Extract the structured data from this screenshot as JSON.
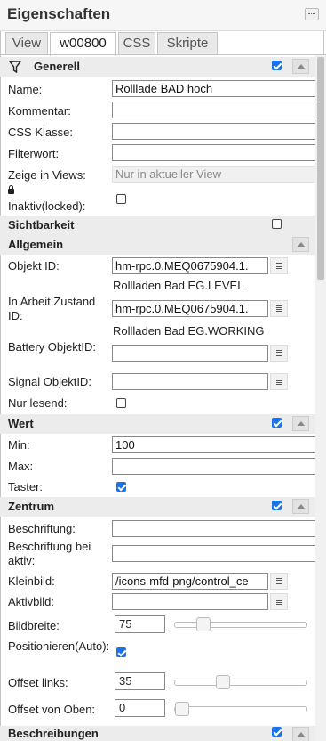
{
  "panel": {
    "title": "Eigenschaften"
  },
  "tabs": [
    {
      "label": "View"
    },
    {
      "label": "w00800"
    },
    {
      "label": "CSS"
    },
    {
      "label": "Skripte"
    }
  ],
  "generell": {
    "header": "Generell",
    "name_label": "Name:",
    "name_value": "Rolllade BAD hoch",
    "kommentar_label": "Kommentar:",
    "kommentar_value": "",
    "css_klasse_label": "CSS Klasse:",
    "css_klasse_value": "",
    "filterwort_label": "Filterwort:",
    "filterwort_value": "",
    "zeige_label": "Zeige in Views:",
    "zeige_value": "Nur in aktueller View",
    "inaktiv_label": "Inaktiv(locked):"
  },
  "sichtbarkeit": {
    "header": "Sichtbarkeit"
  },
  "allgemein": {
    "header": "Allgemein",
    "objekt_id_label": "Objekt ID:",
    "objekt_id_value": "hm-rpc.0.MEQ0675904.1.",
    "objekt_id_name": "Rollladen Bad EG.LEVEL",
    "arbeit_label": "In Arbeit Zustand ID:",
    "arbeit_value": "hm-rpc.0.MEQ0675904.1.",
    "arbeit_name": "Rollladen Bad EG.WORKING",
    "battery_label": "Battery ObjektID:",
    "battery_value": "",
    "signal_label": "Signal ObjektID:",
    "signal_value": "",
    "nur_lesend_label": "Nur lesend:"
  },
  "wert": {
    "header": "Wert",
    "min_label": "Min:",
    "min_value": "100",
    "max_label": "Max:",
    "max_value": "",
    "taster_label": "Taster:"
  },
  "zentrum": {
    "header": "Zentrum",
    "beschriftung_label": "Beschriftung:",
    "beschriftung_value": "",
    "beschriftung_aktiv_label": "Beschriftung bei aktiv:",
    "beschriftung_aktiv_value": "",
    "kleinbild_label": "Kleinbild:",
    "kleinbild_value": "/icons-mfd-png/control_ce",
    "aktivbild_label": "Aktivbild:",
    "aktivbild_value": "",
    "bildbreite_label": "Bildbreite:",
    "bildbreite_value": "75",
    "positionieren_label": "Positionieren(Auto):",
    "offset_links_label": "Offset links:",
    "offset_links_value": "35",
    "offset_oben_label": "Offset von Oben:",
    "offset_oben_value": "0"
  },
  "beschreibungen": {
    "header": "Beschreibungen"
  },
  "sliders": {
    "bildbreite_fraction": 0.18,
    "offset_links_fraction": 0.35,
    "offset_oben_fraction": 0.0
  },
  "colors": {
    "accent": "#1a73e8",
    "section_bg": "#ececec"
  }
}
